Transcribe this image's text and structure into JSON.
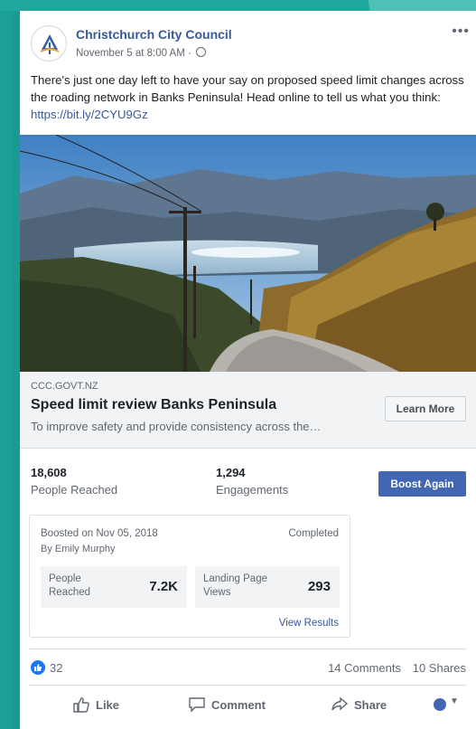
{
  "post": {
    "page_name": "Christchurch City Council",
    "timestamp": "November 5 at 8:00 AM ·",
    "text": "There's just one day left to have your say on proposed speed limit changes across the roading network in Banks Peninsula! Head online to tell us what you think: ",
    "link_text": "https://bit.ly/2CYU9Gz"
  },
  "link_preview": {
    "domain": "CCC.GOVT.NZ",
    "title": "Speed limit review Banks Peninsula",
    "description": "To improve safety and provide consistency across the…",
    "cta_label": "Learn More"
  },
  "stats": {
    "reached_value": "18,608",
    "reached_label": "People Reached",
    "engagements_value": "1,294",
    "engagements_label": "Engagements",
    "boost_again_label": "Boost Again"
  },
  "boost": {
    "boosted_on": "Boosted on Nov 05, 2018",
    "boosted_by": "By Emily Murphy",
    "status": "Completed",
    "people_reached_label": "People Reached",
    "people_reached_value": "7.2K",
    "landing_views_label": "Landing Page Views",
    "landing_views_value": "293",
    "view_results_label": "View Results"
  },
  "reactions": {
    "count": "32",
    "comments": "14 Comments",
    "shares": "10 Shares"
  },
  "actions": {
    "like": "Like",
    "comment": "Comment",
    "share": "Share"
  },
  "colors": {
    "brand_blue": "#4267b2",
    "link_blue": "#385898",
    "background_teal": "#1a9a93"
  }
}
